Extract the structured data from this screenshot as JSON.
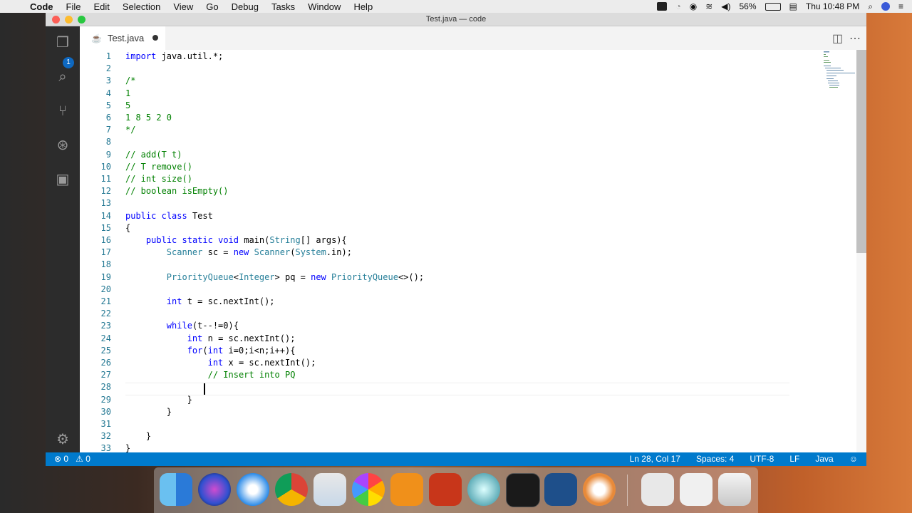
{
  "menubar": {
    "app": "Code",
    "items": [
      "File",
      "Edit",
      "Selection",
      "View",
      "Go",
      "Debug",
      "Tasks",
      "Window",
      "Help"
    ],
    "battery": "56%",
    "clock": "Thu 10:48 PM"
  },
  "window": {
    "title": "Test.java — code"
  },
  "activity": {
    "explorer_badge": "1"
  },
  "tab": {
    "label": "Test.java"
  },
  "code_lines": [
    {
      "n": "1",
      "t": "import java.util.*;"
    },
    {
      "n": "2",
      "t": ""
    },
    {
      "n": "3",
      "t": "/*"
    },
    {
      "n": "4",
      "t": "1"
    },
    {
      "n": "5",
      "t": "5"
    },
    {
      "n": "6",
      "t": "1 8 5 2 0"
    },
    {
      "n": "7",
      "t": "*/"
    },
    {
      "n": "8",
      "t": ""
    },
    {
      "n": "9",
      "t": "// add(T t)"
    },
    {
      "n": "10",
      "t": "// T remove()"
    },
    {
      "n": "11",
      "t": "// int size()"
    },
    {
      "n": "12",
      "t": "// boolean isEmpty()"
    },
    {
      "n": "13",
      "t": ""
    },
    {
      "n": "14",
      "t": "public class Test"
    },
    {
      "n": "15",
      "t": "{"
    },
    {
      "n": "16",
      "t": "    public static void main(String[] args){"
    },
    {
      "n": "17",
      "t": "        Scanner sc = new Scanner(System.in);"
    },
    {
      "n": "18",
      "t": ""
    },
    {
      "n": "19",
      "t": "        PriorityQueue<Integer> pq = new PriorityQueue<>();"
    },
    {
      "n": "20",
      "t": ""
    },
    {
      "n": "21",
      "t": "        int t = sc.nextInt();"
    },
    {
      "n": "22",
      "t": ""
    },
    {
      "n": "23",
      "t": "        while(t--!=0){"
    },
    {
      "n": "24",
      "t": "            int n = sc.nextInt();"
    },
    {
      "n": "25",
      "t": "            for(int i=0;i<n;i++){"
    },
    {
      "n": "26",
      "t": "                int x = sc.nextInt();"
    },
    {
      "n": "27",
      "t": "                // Insert into PQ"
    },
    {
      "n": "28",
      "t": ""
    },
    {
      "n": "29",
      "t": "            }"
    },
    {
      "n": "30",
      "t": "        }"
    },
    {
      "n": "31",
      "t": ""
    },
    {
      "n": "32",
      "t": "    }"
    },
    {
      "n": "33",
      "t": "}"
    }
  ],
  "statusbar": {
    "errors": "0",
    "warnings": "0",
    "position": "Ln 28, Col 17",
    "spaces": "Spaces: 4",
    "encoding": "UTF-8",
    "eol": "LF",
    "language": "Java"
  },
  "dock": {
    "apps": [
      "finder-icon",
      "siri-icon",
      "safari-icon",
      "chrome-icon",
      "preview-icon",
      "photos-icon",
      "ibooks-icon",
      "powerpoint-icon",
      "network-icon",
      "terminal-icon",
      "vscode-icon",
      "flower-app-icon",
      "documents-icon",
      "chrome-window-icon",
      "trash-icon"
    ]
  },
  "colors": {
    "statusbar": "#007acc",
    "activitybar": "#2c2c2c",
    "keyword": "#0000ff",
    "type": "#267f99",
    "comment": "#008000",
    "linenumber": "#237893"
  }
}
